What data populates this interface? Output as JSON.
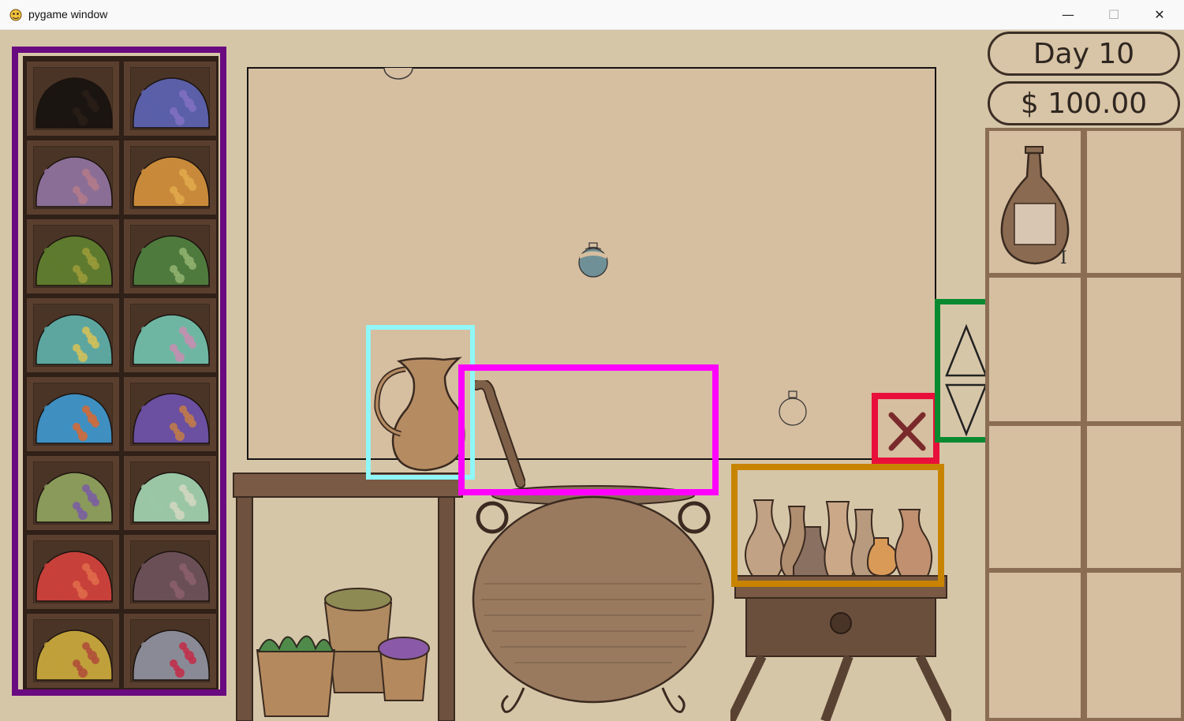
{
  "window": {
    "title": "pygame window",
    "minimize_glyph": "—",
    "maximize_glyph": "☐",
    "close_glyph": "✕"
  },
  "hud": {
    "day_label": "Day 10",
    "money_label": "$ 100.00"
  },
  "ingredients": [
    {
      "name": "ingredient-black",
      "colors": [
        "#1b1512",
        "#2a1d17"
      ]
    },
    {
      "name": "ingredient-blue-purple",
      "colors": [
        "#5a5fa8",
        "#7f6fc0"
      ]
    },
    {
      "name": "ingredient-mauve",
      "colors": [
        "#8b6e96",
        "#b07a8a"
      ]
    },
    {
      "name": "ingredient-orange",
      "colors": [
        "#c88a3a",
        "#e0a84b"
      ]
    },
    {
      "name": "ingredient-olive",
      "colors": [
        "#5e7a2e",
        "#9a9a3a"
      ]
    },
    {
      "name": "ingredient-green",
      "colors": [
        "#4f7a3e",
        "#8fb06e"
      ]
    },
    {
      "name": "ingredient-teal-yellow",
      "colors": [
        "#5da6a0",
        "#d0c05a"
      ]
    },
    {
      "name": "ingredient-mint-pink",
      "colors": [
        "#6fb6a2",
        "#c48fb0"
      ]
    },
    {
      "name": "ingredient-blue-orange",
      "colors": [
        "#3f8fc0",
        "#d06a3a"
      ]
    },
    {
      "name": "ingredient-violet-orange",
      "colors": [
        "#6b4fa0",
        "#c07a4a"
      ]
    },
    {
      "name": "ingredient-sage-purple",
      "colors": [
        "#8a9a5a",
        "#7a5fa0"
      ]
    },
    {
      "name": "ingredient-pale-green",
      "colors": [
        "#9ac6a6",
        "#d0d6c0"
      ]
    },
    {
      "name": "ingredient-red",
      "colors": [
        "#c8403a",
        "#e06a4a"
      ]
    },
    {
      "name": "ingredient-dusky-rose",
      "colors": [
        "#6a4f56",
        "#8a5e6a"
      ]
    },
    {
      "name": "ingredient-gold-red",
      "colors": [
        "#c0a03a",
        "#b0503a"
      ]
    },
    {
      "name": "ingredient-grey-crimson",
      "colors": [
        "#8a8a96",
        "#c0304a"
      ]
    }
  ],
  "inventory": {
    "slot1_item": "potion-bottle",
    "slot1_tier": "I"
  },
  "colors": {
    "shelf_highlight": "#6a0a80",
    "pitcher_highlight": "#8ff7f7",
    "cauldron_highlight": "#ff00ff",
    "cancel_highlight": "#e8103a",
    "scroll_highlight": "#0a8a30",
    "vases_highlight": "#c88400"
  }
}
